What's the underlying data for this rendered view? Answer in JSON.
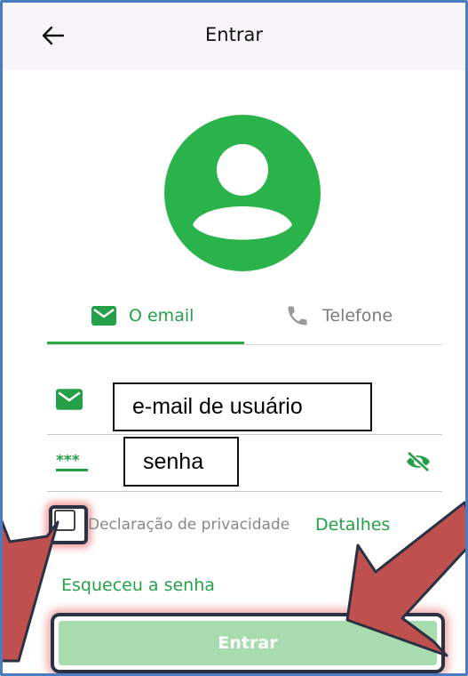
{
  "header": {
    "title": "Entrar",
    "back_icon": "arrow-left-icon"
  },
  "avatar": {
    "icon": "account-circle-icon",
    "color": "#2ab34a"
  },
  "tabs": [
    {
      "label": "O email",
      "icon": "mail-icon",
      "active": true
    },
    {
      "label": "Telefone",
      "icon": "phone-icon",
      "active": false
    }
  ],
  "email_field": {
    "label": "e-mail de usuário",
    "icon": "mail-icon"
  },
  "password_field": {
    "label": "senha",
    "icon": "password-dots-icon",
    "toggle_icon": "eye-off-icon"
  },
  "privacy": {
    "text": "Declaração de privacidade",
    "link": "Detalhes",
    "checked": false
  },
  "forgot_password": "Esqueceu a senha",
  "login_button": "Entrar",
  "colors": {
    "accent": "#2aab44",
    "button_disabled": "#a8dcb0",
    "annotation_arrow": "#c0504d"
  }
}
